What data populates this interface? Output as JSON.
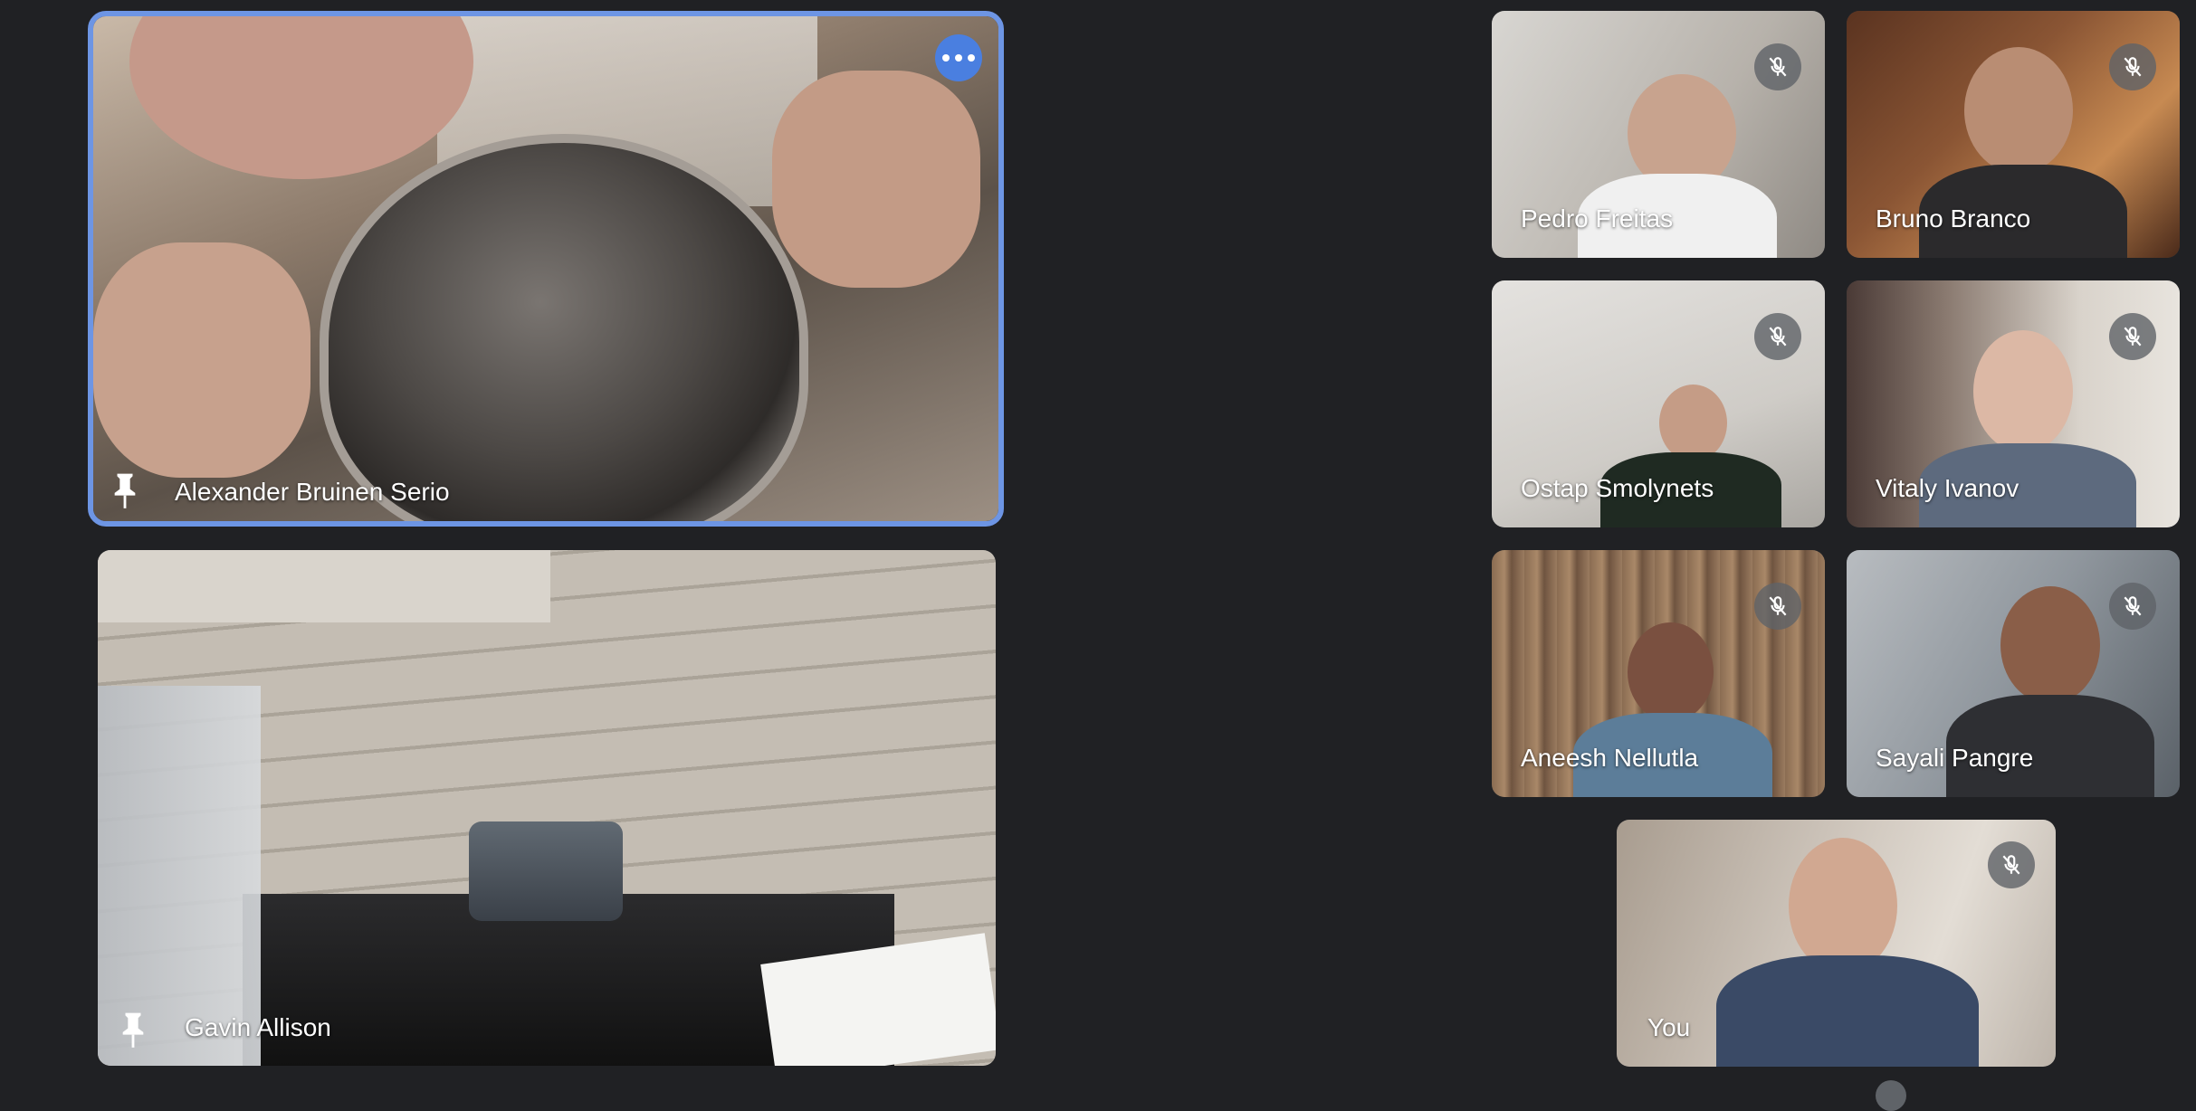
{
  "meeting": {
    "pinned_tiles": [
      {
        "name": "Alexander Bruinen Serio",
        "more_options": "More options"
      },
      {
        "name": "Gavin Allison"
      }
    ],
    "participants": [
      {
        "name": "Pedro Freitas"
      },
      {
        "name": "Bruno Branco"
      },
      {
        "name": "Ostap Smolynets"
      },
      {
        "name": "Vitaly Ivanov"
      },
      {
        "name": "Aneesh Nellutla"
      },
      {
        "name": "Sayali Pangre"
      },
      {
        "name": "You"
      }
    ]
  },
  "colors": {
    "background": "#202124",
    "active_speaker_border": "#6d95e4",
    "more_button": "#4a7fe0"
  },
  "icons": {
    "pin": "pin-icon",
    "mute": "mic-off-icon",
    "more": "more-horiz-icon"
  }
}
